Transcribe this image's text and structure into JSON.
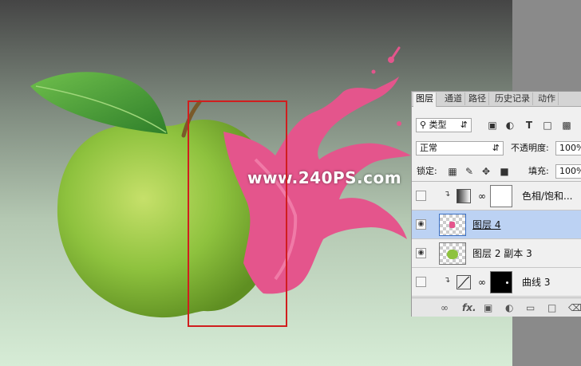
{
  "watermark": "www.240PS.com",
  "colors": {
    "selection": "#d01e1e",
    "selected_row": "#bcd2f3",
    "splash": "#e4558c",
    "apple": "#8ec23e"
  },
  "panel": {
    "tabs": [
      "图层",
      "通道",
      "路径",
      "历史记录",
      "动作"
    ],
    "filter": {
      "search_icon": "magnifier-icon",
      "value": "类型"
    },
    "blend_mode": "正常",
    "opacity_label": "不透明度:",
    "opacity_value": "100%",
    "lock_label": "锁定:",
    "fill_label": "填充:",
    "fill_value": "100%",
    "layers": [
      {
        "name": "色相/饱和...",
        "visible": false,
        "selected": false
      },
      {
        "name": "图层 4",
        "visible": true,
        "selected": true
      },
      {
        "name": "图层 2 副本 3",
        "visible": true,
        "selected": false
      },
      {
        "name": "曲线 3",
        "visible": false,
        "selected": false
      }
    ],
    "footer_fx": "fx."
  }
}
